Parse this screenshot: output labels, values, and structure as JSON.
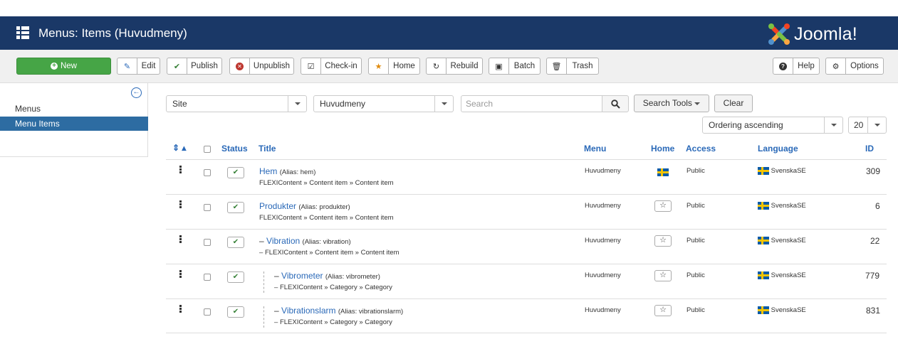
{
  "header": {
    "title": "Menus: Items (Huvudmeny)",
    "logo_text": "Joomla!"
  },
  "toolbar": {
    "new": "New",
    "edit": "Edit",
    "publish": "Publish",
    "unpublish": "Unpublish",
    "checkin": "Check-in",
    "home": "Home",
    "rebuild": "Rebuild",
    "batch": "Batch",
    "trash": "Trash",
    "help": "Help",
    "options": "Options"
  },
  "sidebar": {
    "items": [
      {
        "label": "Menus"
      },
      {
        "label": "Menu Items"
      }
    ]
  },
  "filters": {
    "site": "Site",
    "menu": "Huvudmeny",
    "search_placeholder": "Search",
    "search_tools": "Search Tools",
    "clear": "Clear",
    "ordering": "Ordering ascending",
    "limit": "20"
  },
  "table": {
    "headers": {
      "status": "Status",
      "title": "Title",
      "menu": "Menu",
      "home": "Home",
      "access": "Access",
      "language": "Language",
      "id": "ID"
    },
    "rows": [
      {
        "prefix": "",
        "title": "Hem",
        "alias": "(Alias: hem)",
        "type": "FLEXIContent » Content item » Content item",
        "menu": "Huvudmeny",
        "access": "Public",
        "language": "SvenskaSE",
        "id": "309"
      },
      {
        "prefix": "",
        "title": "Produkter",
        "alias": "(Alias: produkter)",
        "type": "FLEXIContent » Content item » Content item",
        "menu": "Huvudmeny",
        "access": "Public",
        "language": "SvenskaSE",
        "id": "6"
      },
      {
        "prefix": "–",
        "title": "Vibration",
        "alias": "(Alias: vibration)",
        "type": "FLEXIContent » Content item » Content item",
        "menu": "Huvudmeny",
        "access": "Public",
        "language": "SvenskaSE",
        "id": "22"
      },
      {
        "prefix": "–",
        "title": "Vibrometer",
        "alias": "(Alias: vibrometer)",
        "type": "FLEXIContent » Category » Category",
        "menu": "Huvudmeny",
        "access": "Public",
        "language": "SvenskaSE",
        "id": "779"
      },
      {
        "prefix": "–",
        "title": "Vibrationslarm",
        "alias": "(Alias: vibrationslarm)",
        "type": "FLEXIContent » Category » Category",
        "menu": "Huvudmeny",
        "access": "Public",
        "language": "SvenskaSE",
        "id": "831"
      }
    ]
  }
}
